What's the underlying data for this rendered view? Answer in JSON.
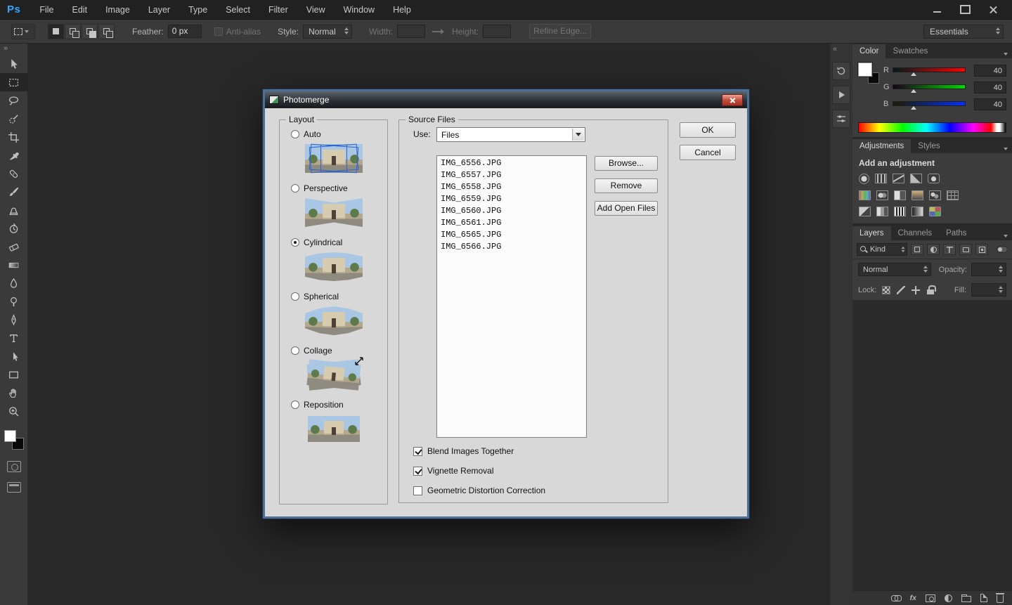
{
  "colors": {
    "ps_blue": "#31a8ff",
    "close_red": "#c24d3c",
    "dialog_bg": "#d8d8d8",
    "panel_bg": "#3c3c3c",
    "canvas_bg": "#282828"
  },
  "icons": {
    "collapse_left": "«",
    "collapse_right": "»"
  },
  "menubar": {
    "logo": "Ps",
    "items": [
      "File",
      "Edit",
      "Image",
      "Layer",
      "Type",
      "Select",
      "Filter",
      "View",
      "Window",
      "Help"
    ]
  },
  "options_bar": {
    "feather_label": "Feather:",
    "feather_value": "0 px",
    "antialias_label": "Anti-alias",
    "style_label": "Style:",
    "style_value": "Normal",
    "width_label": "Width:",
    "height_label": "Height:",
    "refine_edge_label": "Refine Edge...",
    "workspace": "Essentials"
  },
  "panels": {
    "color": {
      "tabs": [
        "Color",
        "Swatches"
      ],
      "channels": [
        {
          "label": "R",
          "value": "40"
        },
        {
          "label": "G",
          "value": "40"
        },
        {
          "label": "B",
          "value": "40"
        }
      ]
    },
    "adjustments": {
      "tab": "Adjustments",
      "styles_tab": "Styles",
      "heading": "Add an adjustment"
    },
    "layers": {
      "tabs": [
        "Layers",
        "Channels",
        "Paths"
      ],
      "kind": "Kind",
      "blend_mode": "Normal",
      "opacity_label": "Opacity:",
      "lock_label": "Lock:",
      "fill_label": "Fill:",
      "fx_label": "fx"
    }
  },
  "dialog": {
    "title": "Photomerge",
    "layout_group": "Layout",
    "layout_options": [
      {
        "label": "Auto",
        "selected": false
      },
      {
        "label": "Perspective",
        "selected": false
      },
      {
        "label": "Cylindrical",
        "selected": true
      },
      {
        "label": "Spherical",
        "selected": false
      },
      {
        "label": "Collage",
        "selected": false
      },
      {
        "label": "Reposition",
        "selected": false
      }
    ],
    "source_group": "Source Files",
    "use_label": "Use:",
    "use_value": "Files",
    "files": [
      "IMG_6556.JPG",
      "IMG_6557.JPG",
      "IMG_6558.JPG",
      "IMG_6559.JPG",
      "IMG_6560.JPG",
      "IMG_6561.JPG",
      "IMG_6565.JPG",
      "IMG_6566.JPG"
    ],
    "browse_button": "Browse...",
    "remove_button": "Remove",
    "add_open_button": "Add Open Files",
    "options": [
      {
        "label": "Blend Images Together",
        "checked": true
      },
      {
        "label": "Vignette Removal",
        "checked": true
      },
      {
        "label": "Geometric Distortion Correction",
        "checked": false
      }
    ],
    "ok_button": "OK",
    "cancel_button": "Cancel"
  }
}
